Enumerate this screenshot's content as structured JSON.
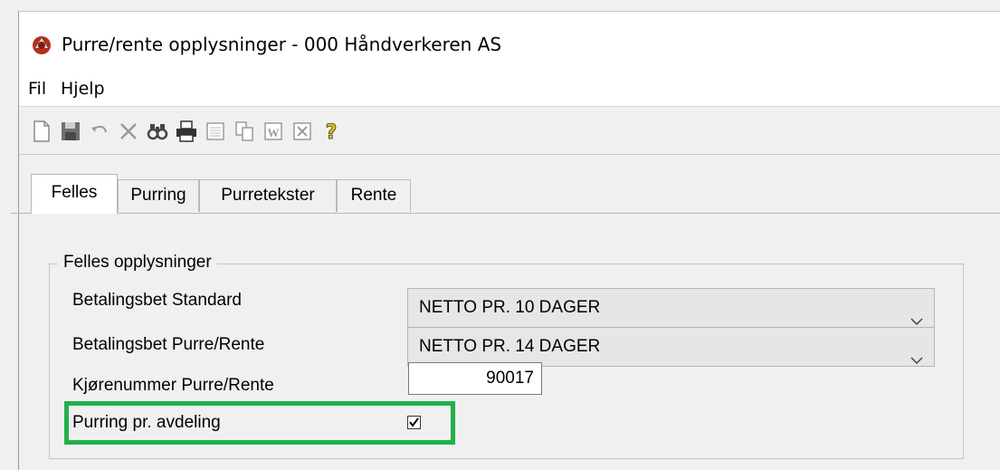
{
  "window": {
    "title": "Purre/rente opplysninger - 000 Håndverkeren AS"
  },
  "menu": [
    "Fil",
    "Hjelp"
  ],
  "toolbar": {
    "icons": [
      "new-icon",
      "save-icon",
      "undo-icon",
      "delete-icon",
      "search-icon",
      "print-icon",
      "preview-icon",
      "copy-icon",
      "word-icon",
      "excel-icon",
      "help-icon"
    ]
  },
  "tabs": [
    {
      "label": "Felles",
      "active": true
    },
    {
      "label": "Purring",
      "active": false
    },
    {
      "label": "Purretekster",
      "active": false
    },
    {
      "label": "Rente",
      "active": false
    }
  ],
  "felles": {
    "group_title": "Felles opplysninger",
    "betalingsbet_standard": {
      "label": "Betalingsbet Standard",
      "value": "NETTO PR. 10 DAGER"
    },
    "betalingsbet_purre": {
      "label": "Betalingsbet Purre/Rente",
      "value": "NETTO PR. 14 DAGER"
    },
    "kjorenummer": {
      "label": "Kjørenummer Purre/Rente",
      "value": "90017"
    },
    "purring_avdeling": {
      "label": "Purring pr. avdeling",
      "checked": true
    }
  },
  "colors": {
    "highlight": "#22b04a"
  }
}
